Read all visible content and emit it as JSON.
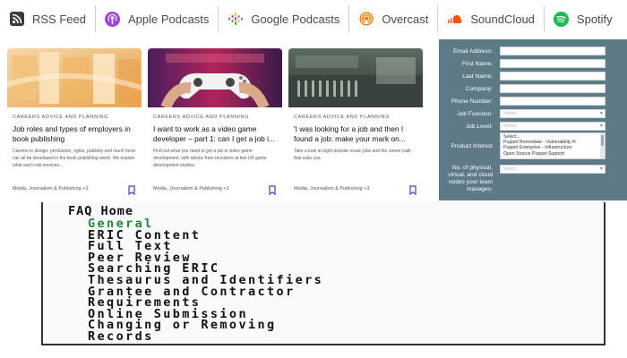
{
  "podcasts": [
    {
      "label": "RSS Feed",
      "icon": "rss-icon",
      "color": "#3b3b3b"
    },
    {
      "label": "Apple Podcasts",
      "icon": "apple-podcasts-icon",
      "color": "#9b47d6"
    },
    {
      "label": "Google Podcasts",
      "icon": "google-podcasts-icon",
      "color": "#4285f4"
    },
    {
      "label": "Overcast",
      "icon": "overcast-icon",
      "color": "#f57c00"
    },
    {
      "label": "SoundCloud",
      "icon": "soundcloud-icon",
      "color": "#ff5500"
    },
    {
      "label": "Spotify",
      "icon": "spotify-icon",
      "color": "#1db954"
    }
  ],
  "cards": [
    {
      "category": "CAREERS ADVICE AND PLANNING",
      "title": "Job roles and types of employers in book publishing",
      "description": "Careers in design, production, rights, publicity and much more can all be developed in the book publishing world. We explain what each role involves...",
      "tags": "Media, Journalism & Publishing +3",
      "image": "books"
    },
    {
      "category": "CAREERS ADVICE AND PLANNING",
      "title": "I want to work as a video game developer – part 1: can I get a job i...",
      "description": "Find out what you need to get a job in video game development, with advice from recruiters at two UK game development studios.",
      "tags": "Media, Journalism & Publishing +3",
      "image": "gamepad"
    },
    {
      "category": "CAREERS ADVICE AND PLANNING",
      "title": "'I was looking for a job and then I found a job: make your mark on...",
      "description": "Take a look at eight popular music jobs and the career path that suits you.",
      "tags": "Media, Journalism & Publishing +3",
      "image": "studio"
    }
  ],
  "form": {
    "email_label": "Email Address:",
    "first_label": "First Name:",
    "last_label": "Last Name:",
    "company_label": "Company:",
    "phone_label": "Phone Number:",
    "job_function_label": "Job Function:",
    "job_function_value": "Select...",
    "job_level_label": "Job Level:",
    "job_level_value": "Select...",
    "product_label": "Product Interest",
    "product_options": [
      "Select...",
      "Puppet Remediate - Vulnerability R",
      "Puppet Enterprise - Infrastructure",
      "Open Source Puppet Support"
    ],
    "nodes_label": "No. of physical, virtual, and cloud nodes your team manages:",
    "nodes_value": "Select..."
  },
  "faq": {
    "home": "FAQ Home",
    "items": [
      {
        "label": "General",
        "active": true
      },
      {
        "label": "ERIC Content",
        "active": false
      },
      {
        "label": "Full Text",
        "active": false
      },
      {
        "label": "Peer Review",
        "active": false
      },
      {
        "label": "Searching ERIC",
        "active": false
      },
      {
        "label": "Thesaurus and Identifiers",
        "active": false
      },
      {
        "label": "Grantee and Contractor",
        "active": false
      },
      {
        "label": "Requirements",
        "active": false
      },
      {
        "label": "Online Submission",
        "active": false
      },
      {
        "label": "Changing or Removing",
        "active": false
      },
      {
        "label": "Records",
        "active": false
      }
    ]
  }
}
